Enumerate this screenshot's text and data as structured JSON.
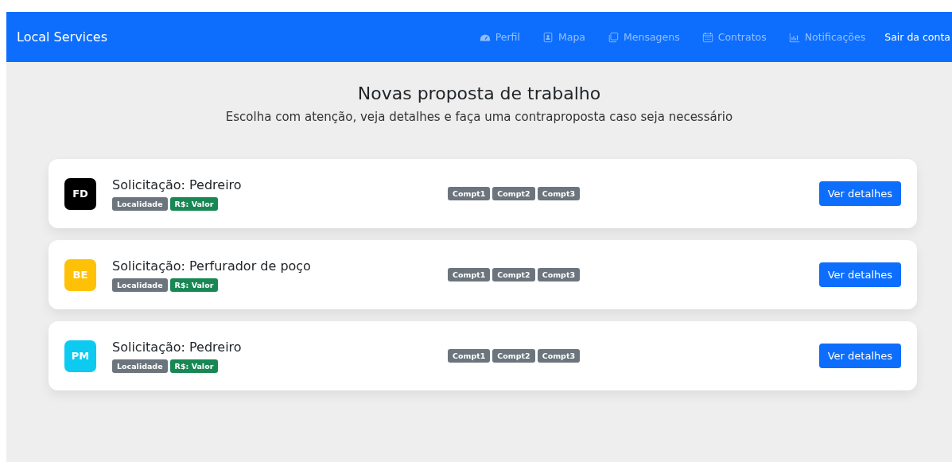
{
  "navbar": {
    "brand": "Local Services",
    "items": [
      {
        "label": "Perfil",
        "kind": "nav"
      },
      {
        "label": "Mapa",
        "kind": "nav"
      },
      {
        "label": "Mensagens",
        "kind": "nav"
      },
      {
        "label": "Contratos",
        "kind": "nav"
      },
      {
        "label": "Notificações",
        "kind": "nav"
      },
      {
        "label": "Sair da conta",
        "kind": "logout"
      }
    ]
  },
  "heading": {
    "title": "Novas proposta de trabalho",
    "subtitle": "Escolha com atenção, veja detalhes e faça uma contraproposta caso seja necessário"
  },
  "proposals": [
    {
      "initials": "FD",
      "color": "#000000",
      "title": "Solicitação: Pedreiro",
      "location": "Localidade",
      "value": "R$: Valor",
      "skills": [
        "Compt1",
        "Compt2",
        "Compt3"
      ],
      "button": "Ver detalhes"
    },
    {
      "initials": "BE",
      "color": "#ffc107",
      "title": "Solicitação: Perfurador de poço",
      "location": "Localidade",
      "value": "R$: Valor",
      "skills": [
        "Compt1",
        "Compt2",
        "Compt3"
      ],
      "button": "Ver detalhes"
    },
    {
      "initials": "PM",
      "color": "#0dcaf0",
      "title": "Solicitação: Pedreiro",
      "location": "Localidade",
      "value": "R$: Valor",
      "skills": [
        "Compt1",
        "Compt2",
        "Compt3"
      ],
      "button": "Ver detalhes"
    }
  ]
}
